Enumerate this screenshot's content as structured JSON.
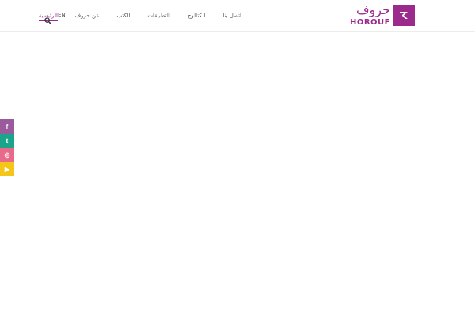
{
  "brand": {
    "name_ar": "حروف",
    "name_en": "HOROUF",
    "color": "#9b2a8c"
  },
  "nav": {
    "items": [
      {
        "label": "الرئيسية",
        "active": true
      },
      {
        "label": "عن حروف"
      },
      {
        "label": "الكتب"
      },
      {
        "label": "التطبيقات"
      },
      {
        "label": "الكتالوج"
      },
      {
        "label": "اتصل بنا"
      }
    ],
    "lang_label": "EN",
    "search_icon": "search-icon"
  },
  "social": [
    {
      "name": "facebook-icon",
      "glyph": "f",
      "color": "#9b5a9b"
    },
    {
      "name": "twitter-icon",
      "glyph": "t",
      "color": "#1aa58a"
    },
    {
      "name": "instagram-icon",
      "glyph": "◎",
      "color": "#e86a8a"
    },
    {
      "name": "youtube-icon",
      "glyph": "▶",
      "color": "#f5c518"
    }
  ]
}
